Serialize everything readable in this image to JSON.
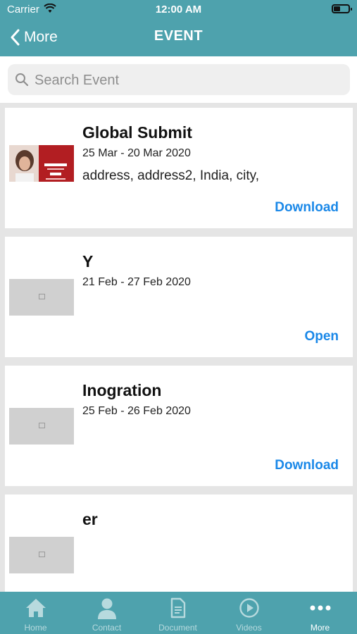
{
  "status": {
    "carrier": "Carrier",
    "time": "12:00 AM"
  },
  "nav": {
    "back_label": "More",
    "title": "EVENT"
  },
  "search": {
    "placeholder": "Search Event",
    "value": ""
  },
  "events": [
    {
      "title": "Global Submit",
      "dates": "25 Mar - 20 Mar 2020",
      "address": "address, address2, India, city,",
      "action": "Download",
      "thumbnail": "promo-photo"
    },
    {
      "title": "Y",
      "dates": "21 Feb - 27 Feb 2020",
      "address": "",
      "action": "Open",
      "thumbnail": "image-placeholder-icon"
    },
    {
      "title": "Inogration",
      "dates": "25 Feb - 26 Feb 2020",
      "address": "",
      "action": "Download",
      "thumbnail": "image-placeholder-icon"
    },
    {
      "title": "er",
      "dates": "",
      "address": "",
      "action": "",
      "thumbnail": "image-placeholder-icon"
    }
  ],
  "tabs": [
    {
      "label": "Home",
      "icon": "home-icon",
      "active": false
    },
    {
      "label": "Contact",
      "icon": "person-icon",
      "active": false
    },
    {
      "label": "Document",
      "icon": "document-icon",
      "active": false
    },
    {
      "label": "Videos",
      "icon": "play-icon",
      "active": false
    },
    {
      "label": "More",
      "icon": "more-icon",
      "active": true
    }
  ],
  "colors": {
    "bar": "#4ea2ad",
    "link": "#1a88e8",
    "tab_inactive": "#b7dade",
    "tab_active": "#ffffff"
  }
}
